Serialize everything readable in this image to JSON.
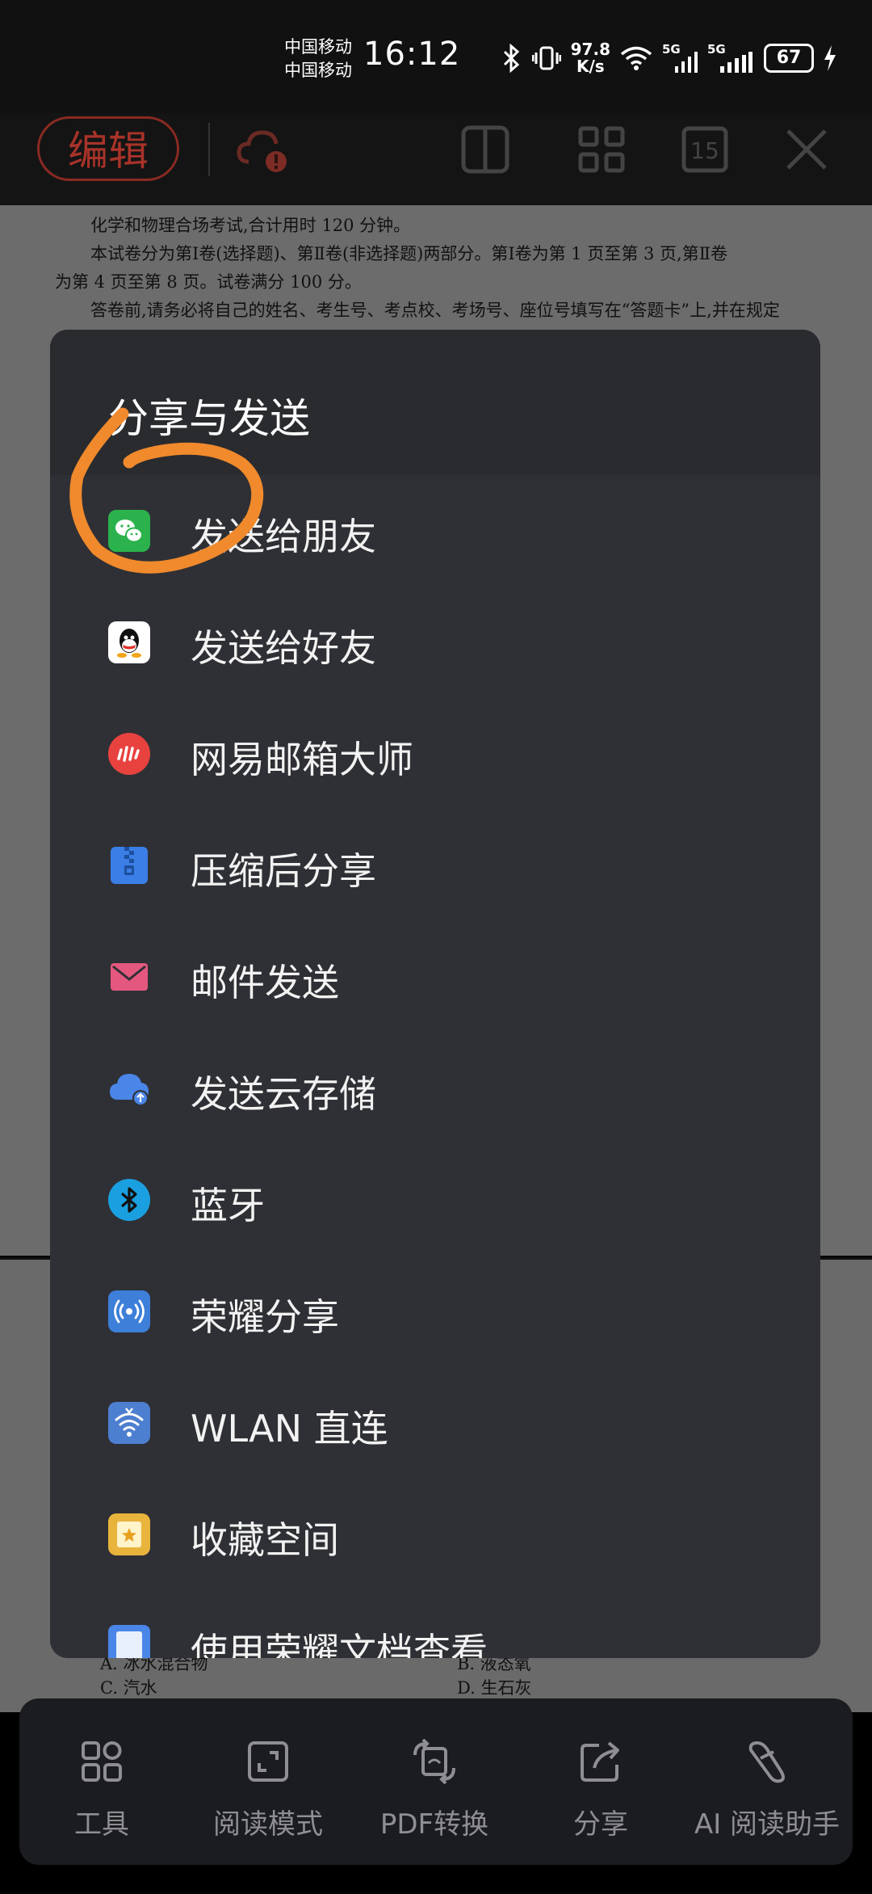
{
  "status_bar": {
    "carrier_1": "中国移动",
    "carrier_2": "中国移动",
    "time": "16:12",
    "net_speed_value": "97.8",
    "net_speed_unit": "K/s",
    "signal_label_1": "5G",
    "signal_label_2": "5G",
    "battery": "67"
  },
  "toolbar": {
    "edit_label": "编辑"
  },
  "document": {
    "lines": [
      "化学和物理合场考试,合计用时 120 分钟。",
      "本试卷分为第Ⅰ卷(选择题)、第Ⅱ卷(非选择题)两部分。第Ⅰ卷为第 1 页至第 3 页,第Ⅱ卷",
      "为第 4 页至第 8 页。试卷满分 100 分。",
      "答卷前,请务必将自己的姓名、考生号、考点校、考场号、座位号填写在“答题卡”上,并在规定"
    ],
    "option_a": "A. 冰水混合物",
    "option_b": "B. 液态氧",
    "option_c": "C. 汽水",
    "option_d": "D. 生石灰"
  },
  "dialog": {
    "title": "分享与发送",
    "items": [
      {
        "label": "发送给朋友",
        "icon": "wechat-icon",
        "color": "#2bb24c"
      },
      {
        "label": "发送给好友",
        "icon": "qq-icon",
        "color": "#ffffff"
      },
      {
        "label": "网易邮箱大师",
        "icon": "netease-mail-icon",
        "color": "#e8423f"
      },
      {
        "label": "压缩后分享",
        "icon": "zip-icon",
        "color": "#3a7ee6"
      },
      {
        "label": "邮件发送",
        "icon": "mail-icon",
        "color": "#e4587f"
      },
      {
        "label": "发送云存储",
        "icon": "cloud-upload-icon",
        "color": "#4a86e8"
      },
      {
        "label": "蓝牙",
        "icon": "bluetooth-icon",
        "color": "#1aa0e0"
      },
      {
        "label": "荣耀分享",
        "icon": "honor-share-icon",
        "color": "#3d7fd9"
      },
      {
        "label": "WLAN 直连",
        "icon": "wlan-direct-icon",
        "color": "#4d7fd0"
      },
      {
        "label": "收藏空间",
        "icon": "favorites-space-icon",
        "color": "#e8b43c"
      },
      {
        "label": "使用荣耀文档查看",
        "icon": "honor-docs-icon",
        "color": "#4a86e8"
      }
    ]
  },
  "bottom_bar": {
    "items": [
      {
        "label": "工具",
        "icon": "tools-icon"
      },
      {
        "label": "阅读模式",
        "icon": "reading-mode-icon"
      },
      {
        "label": "PDF转换",
        "icon": "pdf-convert-icon"
      },
      {
        "label": "分享",
        "icon": "share-icon"
      },
      {
        "label": "AI 阅读助手",
        "icon": "ai-assistant-icon"
      }
    ]
  },
  "colors": {
    "accent": "#a83329",
    "dialog_bg": "#2f3035",
    "annotation_stroke": "#f08a2c"
  }
}
